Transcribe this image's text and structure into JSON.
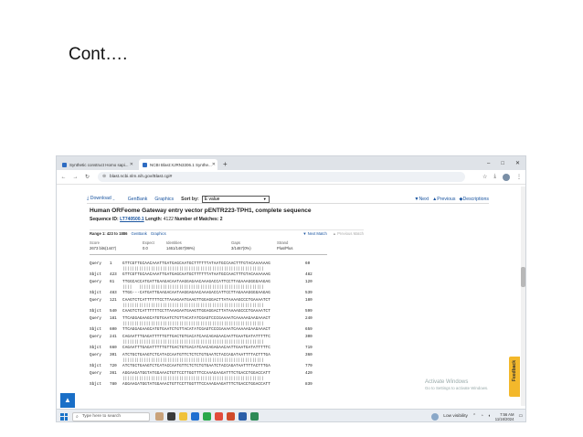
{
  "slide": {
    "title": "Cont…."
  },
  "browser": {
    "tabs": [
      {
        "label": "Synthetic construct Homo sapi..."
      },
      {
        "label": "NCBI Blast:XJRN3306.1 Synthe..."
      }
    ],
    "new_tab": "+",
    "url": "blast.ncbi.nlm.nih.gov/Blast.cgi#",
    "controls": {
      "min": "–",
      "max": "□",
      "close": "✕"
    }
  },
  "toolbar": {
    "download": "Download",
    "genbank": "GenBank",
    "graphics": "Graphics",
    "sort_by": "Sort by:",
    "sort_value": "E value",
    "next": "Next",
    "previous": "Previous",
    "descriptions": "Descriptions"
  },
  "hit": {
    "title": "Human ORFeome Gateway entry vector pENTR223-TPH1, complete sequence",
    "seq_id_label": "Sequence ID:",
    "seq_id": "LT740500.1",
    "length_label": "Length:",
    "length": "4122",
    "matches_label": "Number of Matches:",
    "matches": "2"
  },
  "range": {
    "text": "Range 1: 423 to 1886",
    "genbank": "GenBank",
    "graphics": "Graphics",
    "next_match": "Next Match",
    "prev_match": "Previous Match"
  },
  "stats": {
    "headers": [
      "Score",
      "Expect",
      "Identities",
      "Gaps",
      "Strand"
    ],
    "values": [
      "2673 bits(1447)",
      "0.0",
      "1461/1467(99%)",
      "3/1467(0%)",
      "Plus/Plus"
    ]
  },
  "alignment": [
    {
      "q_start": "1",
      "q_seq": "GTTCGTTGCAACAAATTGATGAGCAATGCTTTTTTATAATGCCAACTTTGTACAAAAAAG",
      "q_end": "60",
      "s_start": "423",
      "s_seq": "GTTCGTTGCAACAAATTGATGAGCAATGCTTTTTTATAATGCCAACTTTGTACAAAAAAG",
      "s_end": "482"
    },
    {
      "q_start": "61",
      "q_seq": "TTGGCACCATGATTGAAGACAATAAGGAGAACAAAGACCATTCCTTAGAAAGGGGAAGAG",
      "q_end": "120",
      "s_start": "483",
      "s_seq": "TTGG---CATGATTGAAGACAATAAGGAGAACAAAGACCATTCCTTAGAAAGGGGAAGAG",
      "s_end": "539"
    },
    {
      "q_start": "121",
      "q_seq": "CAAGTCTCATTTTTTCCTTAAAGAATGAAGTTGGAGGACTTATAAAAGCCCTGAAAATCT",
      "q_end": "180",
      "s_start": "540",
      "s_seq": "CAAGTCTCATTTTTTCCTTAAAGAATGAAGTTGGAGGACTTATAAAAGCCCTGAAAATCT",
      "s_end": "599"
    },
    {
      "q_start": "181",
      "q_seq": "TTCAGGAGAAGCATGTGAATCTGTTACATATCGAGTCCCGAAAATCAAAAAGAAGAAACT",
      "q_end": "240",
      "s_start": "600",
      "s_seq": "TTCAGGAGAAGCATGTGAATCTGTTACATATCGAGTCCCGAAAATCAAAAAGAAGAAACT",
      "s_end": "659"
    },
    {
      "q_start": "241",
      "q_seq": "CAGAATTTGAGATTTTTGTTGACTGTGACATCAACAGAGAACAATTGAATGATATTTTTC",
      "q_end": "300",
      "s_start": "660",
      "s_seq": "CAGAATTTGAGATTTTTGTTGACTGTGACATCAACAGAGAACAATTGAATGATATTTTTC",
      "s_end": "719"
    },
    {
      "q_start": "301",
      "q_seq": "ATCTGCTGAAGTCTCATACCAATGTTCTCTCTGTGAATCTACCAGATAATTTTACTTTGA",
      "q_end": "360",
      "s_start": "720",
      "s_seq": "ATCTGCTGAAGTCTCATACCAATGTTCTCTCTGTGAATCTACCAGATAATTTTACTTTGA",
      "s_end": "779"
    },
    {
      "q_start": "361",
      "q_seq": "AGGAAGATGGTATGGAAACTGTTCCTTGGTTTCCAAAGAAGATTTCTGACCTGGACCATT",
      "q_end": "420",
      "s_start": "780",
      "s_seq": "AGGAAGATGGTATGGAAACTGTTCCTTGGTTTCCAAAGAAGATTTCTGACCTGGACCATT",
      "s_end": "839"
    }
  ],
  "alignment_labels": {
    "query": "Query",
    "subject": "Sbjct"
  },
  "watermark": {
    "title": "Activate Windows",
    "subtitle": "Go to Settings to activate Windows."
  },
  "feedback": "Feedback",
  "taskbar": {
    "search_placeholder": "Type here to search",
    "visibility": "Low visibility",
    "time": "7:56 AM",
    "date": "11/16/2024"
  },
  "colors": {
    "link": "#1a55a0",
    "feedback": "#f3b82b",
    "back_to_top": "#1a6fc7",
    "windows_blue": "#1a73c8"
  }
}
